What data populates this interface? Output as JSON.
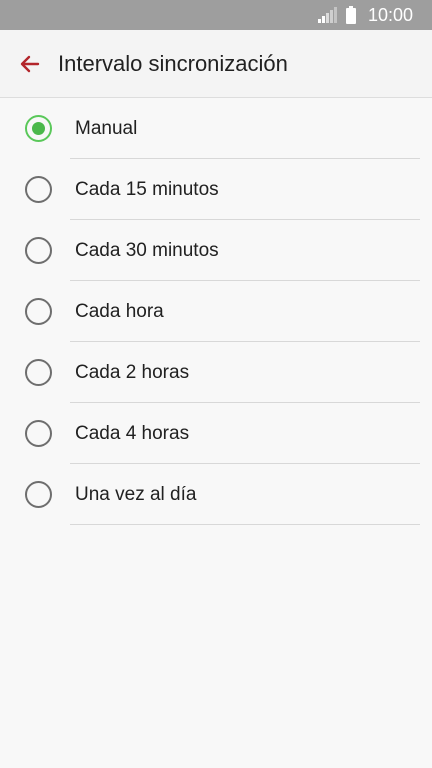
{
  "status_bar": {
    "time": "10:00",
    "signal_icon": "signal-icon",
    "battery_icon": "battery-icon"
  },
  "app_bar": {
    "title": "Intervalo sincronización",
    "back_icon": "back-arrow-icon",
    "accent_color": "#b3262b"
  },
  "options": [
    {
      "label": "Manual",
      "selected": true
    },
    {
      "label": "Cada 15 minutos",
      "selected": false
    },
    {
      "label": "Cada 30 minutos",
      "selected": false
    },
    {
      "label": "Cada hora",
      "selected": false
    },
    {
      "label": "Cada 2 horas",
      "selected": false
    },
    {
      "label": "Cada 4 horas",
      "selected": false
    },
    {
      "label": "Una vez al día",
      "selected": false
    }
  ],
  "colors": {
    "status_bar": "#9e9e9e",
    "radio_selected": "#4bb84b",
    "radio_unselected": "#6e6e6e"
  }
}
